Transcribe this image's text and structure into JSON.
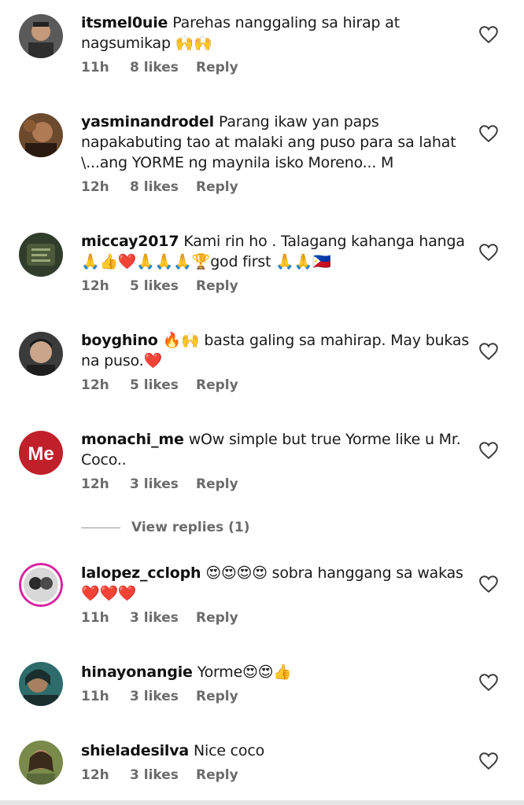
{
  "comments": [
    {
      "username": "itsmel0uie",
      "text": "Parehas nanggaling sa hirap at nagsumikap 🙌🙌",
      "time": "11h",
      "likes": "8 likes",
      "reply": "Reply",
      "avatar": {
        "bg": "#5a5a5a",
        "fg": "#2e2e2e"
      }
    },
    {
      "username": "yasminandrodel",
      "text": "Parang ikaw yan paps napakabuting tao at malaki ang puso para sa lahat \\...ang YORME ng maynila isko Moreno... M",
      "time": "12h",
      "likes": "8 likes",
      "reply": "Reply",
      "avatar": {
        "bg": "#6b4a2e",
        "fg": "#2a1a10"
      }
    },
    {
      "username": "miccay2017",
      "text": "Kami rin ho . Talagang kahanga hanga 🙏👍❤️🙏🙏🙏🏆god first 🙏🙏🇵🇭",
      "time": "12h",
      "likes": "5 likes",
      "reply": "Reply",
      "avatar": {
        "bg": "#2f3d2a",
        "fg": "#6a7a4a"
      }
    },
    {
      "username": "boyghino",
      "text": "🔥🙌 basta galing sa mahirap. May bukas na puso.❤️",
      "time": "12h",
      "likes": "5 likes",
      "reply": "Reply",
      "avatar": {
        "bg": "#3b3b3b",
        "fg": "#caa58a"
      }
    },
    {
      "username": "monachi_me",
      "text": "wOw simple but true Yorme like u Mr. Coco..",
      "time": "12h",
      "likes": "3 likes",
      "reply": "Reply",
      "avatar": {
        "bg": "#c0202a",
        "fg": "#ffffff",
        "label": "Me"
      }
    },
    {
      "username": "lalopez_ccloph",
      "text": "😍😍😍😍 sobra hanggang sa wakas ❤️❤️❤️",
      "time": "11h",
      "likes": "3 likes",
      "reply": "Reply",
      "avatar": {
        "bg": "#d8d8d8",
        "fg": "#2a2a2a",
        "ring": "#d6249f"
      }
    },
    {
      "username": "hinayonangie",
      "text": "Yorme😍😍👍",
      "time": "11h",
      "likes": "3 likes",
      "reply": "Reply",
      "avatar": {
        "bg": "#2e6b6b",
        "fg": "#1a2e2e"
      }
    },
    {
      "username": "shieladesilva",
      "text": "Nice coco",
      "time": "12h",
      "likes": "3 likes",
      "reply": "Reply",
      "avatar": {
        "bg": "#7a8a4a",
        "fg": "#3a2a1a"
      }
    }
  ],
  "view_replies": "View replies (1)",
  "colors": {
    "text": "#1a1a1a",
    "meta": "#6b6b6b",
    "heart_stroke": "#3a3a3a"
  },
  "icons": {
    "like": "heart-outline-icon"
  }
}
